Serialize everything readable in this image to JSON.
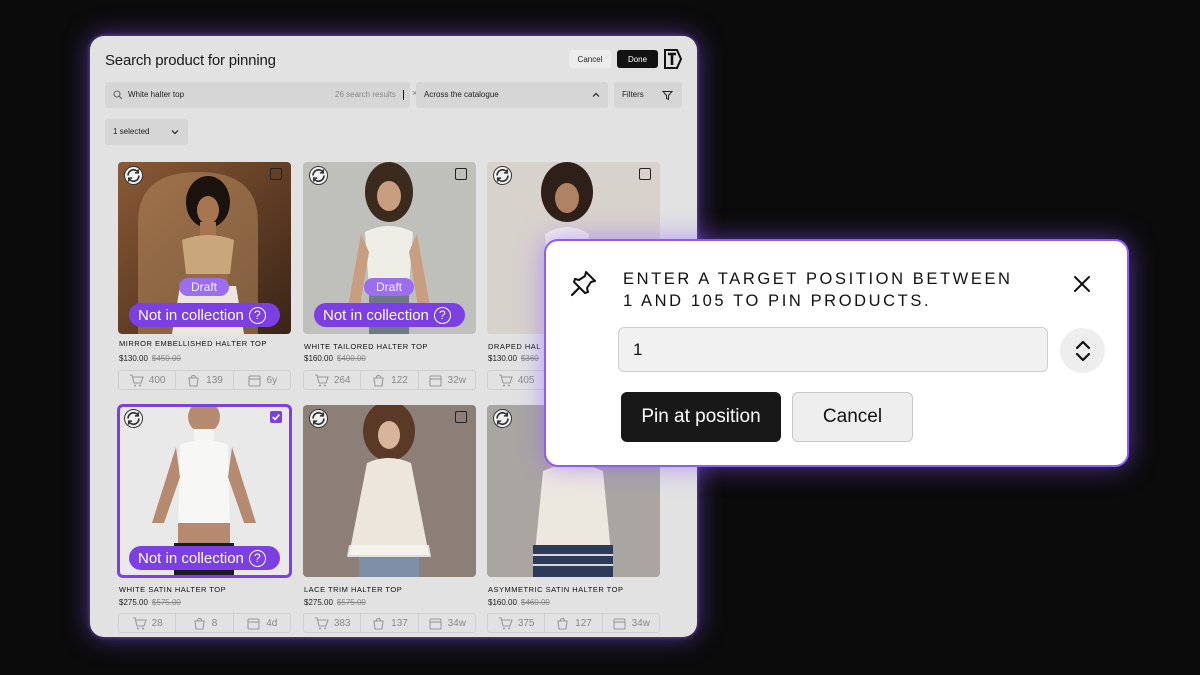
{
  "accent": "#7b3fe4",
  "panel": {
    "title": "Search product for pinning",
    "cancel_label": "Cancel",
    "done_label": "Done",
    "logo_icon": "brand-logo-icon"
  },
  "search": {
    "value": "White halter top",
    "result_count": "26 search results",
    "clear_glyph": "×"
  },
  "scope": {
    "label": "Across the catalogue"
  },
  "filters": {
    "label": "Filters"
  },
  "selection": {
    "label": "1 selected"
  },
  "products": [
    {
      "name": "MIRROR EMBELLISHED HALTER TOP",
      "price": "$130.00",
      "was": "$450.00",
      "draft": "Draft",
      "badge": "Not in collection",
      "q": "?",
      "carts": "400",
      "orders": "139",
      "age": "6y",
      "checked": false
    },
    {
      "name": "WHITE TAILORED HALTER TOP",
      "price": "$160.00",
      "was": "$400.00",
      "draft": "Draft",
      "badge": "Not in collection",
      "q": "?",
      "carts": "264",
      "orders": "122",
      "age": "32w",
      "checked": false
    },
    {
      "name": "DRAPED HAL",
      "price": "$130.00",
      "was": "$360",
      "carts": "405",
      "checked": false
    },
    {
      "name": "WHITE SATIN HALTER TOP",
      "price": "$275.00",
      "was": "$575.00",
      "badge": "Not in collection",
      "q": "?",
      "carts": "28",
      "orders": "8",
      "age": "4d",
      "checked": true
    },
    {
      "name": "LACE TRIM HALTER TOP",
      "price": "$275.00",
      "was": "$575.00",
      "carts": "383",
      "orders": "137",
      "age": "34w",
      "checked": false
    },
    {
      "name": "ASYMMETRIC SATIN HALTER TOP",
      "price": "$160.00",
      "was": "$460.00",
      "carts": "375",
      "orders": "127",
      "age": "34w",
      "checked": false
    }
  ],
  "modal": {
    "title": "ENTER A TARGET POSITION BETWEEN 1 AND 105 TO PIN PRODUCTS.",
    "position_value": "1",
    "pin_label": "Pin at position",
    "cancel_label": "Cancel"
  }
}
